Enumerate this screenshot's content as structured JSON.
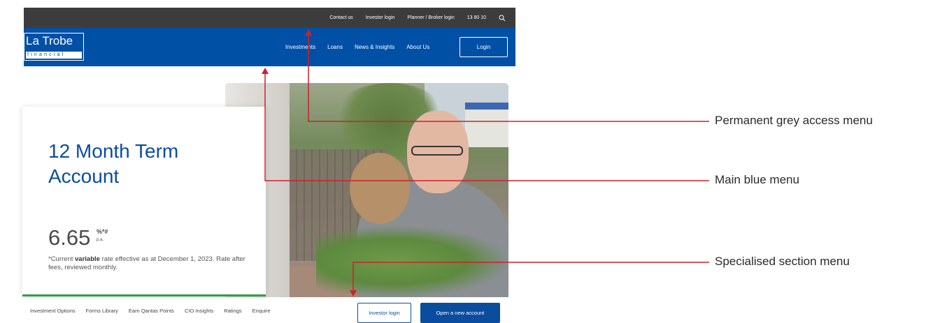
{
  "top_bar": {
    "links": [
      "Contact us",
      "Investor login",
      "Planner / Broker login",
      "13 80 10"
    ],
    "search_icon": "search-icon"
  },
  "main_nav": {
    "logo": {
      "name": "La Trobe",
      "sub": "financial"
    },
    "items": [
      "Investments",
      "Loans",
      "News & Insights",
      "About Us"
    ],
    "login_label": "Login"
  },
  "card": {
    "title": "12 Month Term Account",
    "rate": "6.65",
    "rate_suffix": "%*#",
    "rate_unit": "p.a.",
    "note_prefix": "*Current ",
    "note_bold": "variable",
    "note_suffix": " rate effective as at December 1, 2023. Rate after fees, reviewed monthly."
  },
  "section_menu": {
    "items": [
      "Investment Options",
      "Forms Library",
      "Earn Qantas Points",
      "CIO Insights",
      "Ratings",
      "Enquire"
    ],
    "investor_login_label": "Investor login",
    "open_account_label": "Open a new account"
  },
  "annotations": [
    {
      "label": "Permanent grey access menu"
    },
    {
      "label": "Main blue menu"
    },
    {
      "label": "Specialised section menu"
    }
  ],
  "colors": {
    "grey_bar": "#3c3c3c",
    "blue_bar": "#0050a6",
    "title_blue": "#0a4d9e",
    "card_accent_green": "#2e9e48",
    "annotation_red": "#cc2229"
  }
}
